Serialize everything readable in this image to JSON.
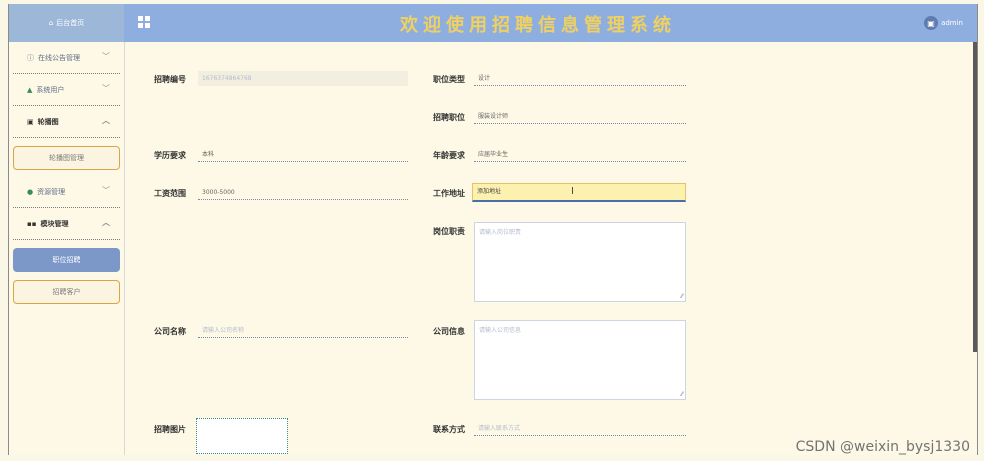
{
  "header": {
    "title": "欢迎使用招聘信息管理系统",
    "user": "admin"
  },
  "sidebar": {
    "home": "后台首页",
    "menus": [
      {
        "label": "在线公告管理",
        "expanded": false
      },
      {
        "label": "系统用户",
        "expanded": false
      },
      {
        "label": "轮播图",
        "expanded": true,
        "sub": [
          "轮播图管理"
        ]
      },
      {
        "label": "资源管理",
        "expanded": false
      },
      {
        "label": "模块管理",
        "expanded": true,
        "sub": [
          "职位招聘",
          "招聘客户"
        ]
      }
    ],
    "active_sub": "职位招聘"
  },
  "form": {
    "zpbh": {
      "label": "招聘编号",
      "value": "1676374864768"
    },
    "zwlx": {
      "label": "职位类型",
      "value": "设计"
    },
    "zpzw": {
      "label": "招聘职位",
      "value": "服装设计师"
    },
    "xlyq": {
      "label": "学历要求",
      "value": "本科"
    },
    "nlyq": {
      "label": "年龄要求",
      "value": "应届毕业生"
    },
    "gzfw": {
      "label": "工资范围",
      "value": "3000-5000"
    },
    "gzdz": {
      "label": "工作地址",
      "value": "添加地址"
    },
    "gwzz": {
      "label": "岗位职责",
      "placeholder": "请输入岗位职责"
    },
    "gsmc": {
      "label": "公司名称",
      "placeholder": "请输入公司名称"
    },
    "gsxx": {
      "label": "公司信息",
      "placeholder": "请输入公司信息"
    },
    "zptp": {
      "label": "招聘图片"
    },
    "lxfs": {
      "label": "联系方式",
      "placeholder": "请输入联系方式"
    }
  },
  "watermark": "CSDN @weixin_bysj1330"
}
